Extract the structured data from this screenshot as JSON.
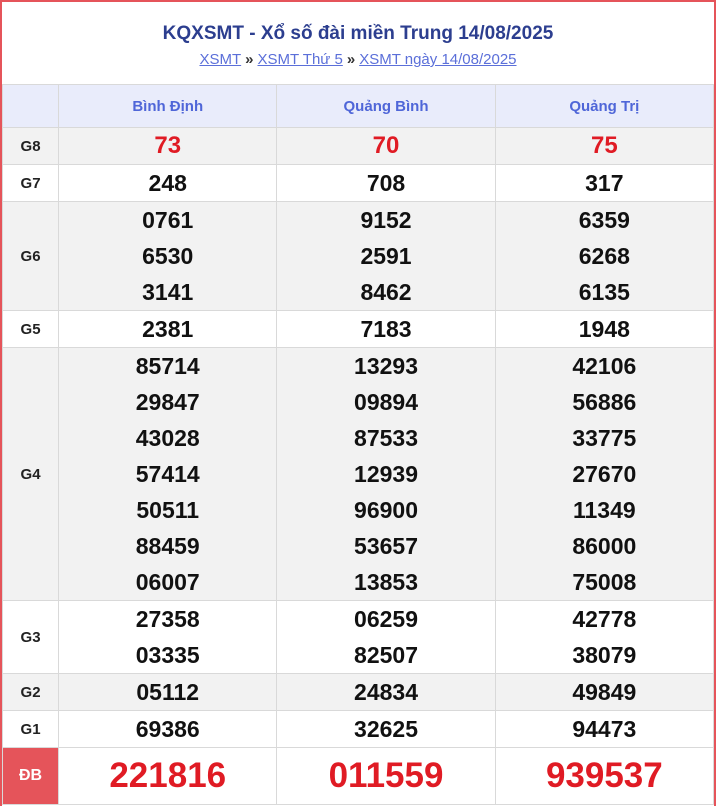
{
  "header": {
    "title": "KQXSMT - Xổ số đài miền Trung 14/08/2025",
    "crumbs": [
      "XSMT",
      "XSMT Thứ 5",
      "XSMT ngày 14/08/2025"
    ],
    "separator": "»"
  },
  "provinces": [
    "Bình Định",
    "Quảng Bình",
    "Quảng Trị"
  ],
  "prizes": [
    {
      "label": "G8",
      "values": [
        [
          "73"
        ],
        [
          "70"
        ],
        [
          "75"
        ]
      ]
    },
    {
      "label": "G7",
      "values": [
        [
          "248"
        ],
        [
          "708"
        ],
        [
          "317"
        ]
      ]
    },
    {
      "label": "G6",
      "values": [
        [
          "0761",
          "6530",
          "3141"
        ],
        [
          "9152",
          "2591",
          "8462"
        ],
        [
          "6359",
          "6268",
          "6135"
        ]
      ]
    },
    {
      "label": "G5",
      "values": [
        [
          "2381"
        ],
        [
          "7183"
        ],
        [
          "1948"
        ]
      ]
    },
    {
      "label": "G4",
      "values": [
        [
          "85714",
          "29847",
          "43028",
          "57414",
          "50511",
          "88459",
          "06007"
        ],
        [
          "13293",
          "09894",
          "87533",
          "12939",
          "96900",
          "53657",
          "13853"
        ],
        [
          "42106",
          "56886",
          "33775",
          "27670",
          "11349",
          "86000",
          "75008"
        ]
      ]
    },
    {
      "label": "G3",
      "values": [
        [
          "27358",
          "03335"
        ],
        [
          "06259",
          "82507"
        ],
        [
          "42778",
          "38079"
        ]
      ]
    },
    {
      "label": "G2",
      "values": [
        [
          "05112"
        ],
        [
          "24834"
        ],
        [
          "49849"
        ]
      ]
    },
    {
      "label": "G1",
      "values": [
        [
          "69386"
        ],
        [
          "32625"
        ],
        [
          "94473"
        ]
      ]
    }
  ],
  "special": {
    "label": "ĐB",
    "values": [
      "221816",
      "011559",
      "939537"
    ]
  },
  "colors": {
    "border": "#e5545a",
    "header_bg": "#e9ecfb",
    "title": "#2c3e8f",
    "red": "#e01b24"
  }
}
